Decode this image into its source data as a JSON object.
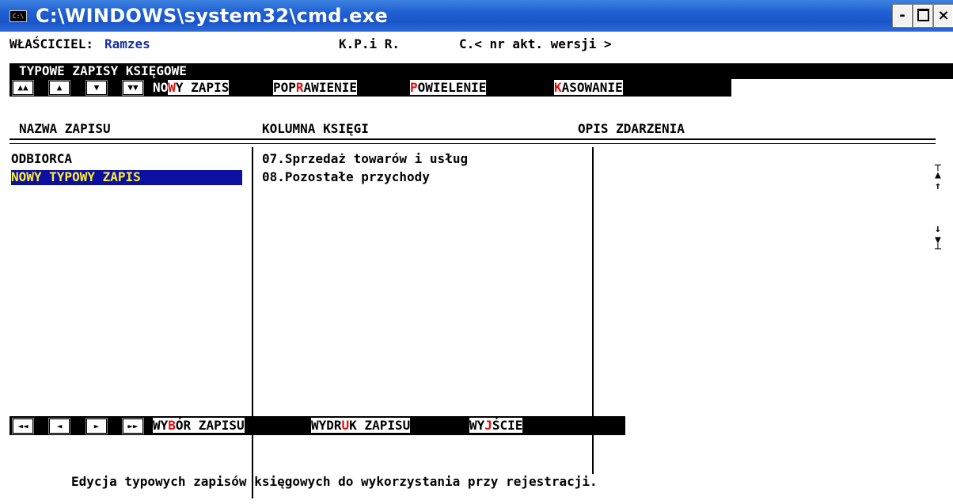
{
  "window": {
    "title": "C:\\WINDOWS\\system32\\cmd.exe",
    "icon_label": "C:\\",
    "buttons": {
      "minimize": "-",
      "maximize": "□",
      "close": "×"
    }
  },
  "status": {
    "owner_label": "WŁAŚCICIEL:",
    "owner_value": "Ramzes",
    "program": "K.P.i R.",
    "version": "C.< nr akt. wersji >"
  },
  "section_title": "TYPOWE ZAPISY KSIĘGOWE",
  "nav_buttons": [
    "▲▲",
    "▲",
    "▼",
    "▼▼"
  ],
  "top_menu": [
    {
      "pre": "NO",
      "key": "W",
      "post": "Y ZAPIS"
    },
    {
      "pre": "POP",
      "key": "R",
      "post": "AWIENIE"
    },
    {
      "pre": "",
      "key": "P",
      "post": "OWIELENIE"
    },
    {
      "pre": "",
      "key": "K",
      "post": "ASOWANIE"
    }
  ],
  "columns": {
    "name": "NAZWA ZAPISU",
    "column": "KOLUMNA KSIĘGI",
    "description": "OPIS ZDARZENIA"
  },
  "rows": [
    {
      "name": "ODBIORCA",
      "column": "07.Sprzedaż towarów i usług",
      "description": ""
    },
    {
      "name": "NOWY TYPOWY ZAPIS",
      "column": "08.Pozostałe przychody",
      "description": ""
    }
  ],
  "scroll_glyphs": [
    "┬",
    "▲",
    "↑",
    "↓",
    "▼",
    "┴"
  ],
  "footer_nav_buttons": [
    "◄◄",
    "◄",
    "►",
    "►►"
  ],
  "footer_menu": [
    {
      "pre": "WY",
      "key": "B",
      "post": "ÓR ZAPISU"
    },
    {
      "pre": "WYDR",
      "key": "U",
      "post": "K ZAPISU"
    },
    {
      "pre": "WY",
      "key": "J",
      "post": "ŚCIE"
    }
  ],
  "help_text": "Edycja typowych zapisów księgowych do wykorzystania przy rejestracji.",
  "colors": {
    "titlebar": "#1f5fd1",
    "highlight_row_bg": "#0c10a0",
    "highlight_row_text": "#ffef30",
    "hotkey": "#e01010",
    "owner_name": "#1a2fa0"
  }
}
